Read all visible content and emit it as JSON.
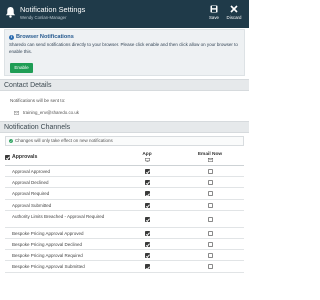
{
  "header": {
    "title": "Notification Settings",
    "subtitle": "Wendy Conlan-Manager",
    "save_label": "Save",
    "discard_label": "Discard",
    "background": "#1f3a49"
  },
  "browser_alert": {
    "title": "Browser Notifications",
    "text": "Sharedo can send notifications directly to your browser. Please click enable and then click allow on your browser to enable this.",
    "enable_label": "Enable",
    "accent": "#1f9d55"
  },
  "contact": {
    "heading": "Contact Details",
    "sent_to_label": "Notifications will be sent to:",
    "email": "training_env@sharedo.co.uk"
  },
  "channels": {
    "heading": "Notification Channels",
    "note": "Changes will only take effect on new notifications",
    "group_label": "Approvals",
    "col_app": "App",
    "col_email": "Email Now",
    "rows": [
      {
        "label": "Approval Approved",
        "app": true,
        "email": false
      },
      {
        "label": "Approval Declined",
        "app": true,
        "email": false
      },
      {
        "label": "Approval Required",
        "app": true,
        "email": false
      },
      {
        "label": "Approval Submitted",
        "app": true,
        "email": false
      },
      {
        "label": "Authority Limits Breached - Approval Required",
        "app": true,
        "email": false
      },
      {
        "label": "Bespoke Pricing Approval Approved",
        "app": true,
        "email": false
      },
      {
        "label": "Bespoke Pricing Approval Declined",
        "app": true,
        "email": false
      },
      {
        "label": "Bespoke Pricing Approval Required",
        "app": true,
        "email": false
      },
      {
        "label": "Bespoke Pricing Approval Submitted",
        "app": true,
        "email": false
      }
    ]
  }
}
